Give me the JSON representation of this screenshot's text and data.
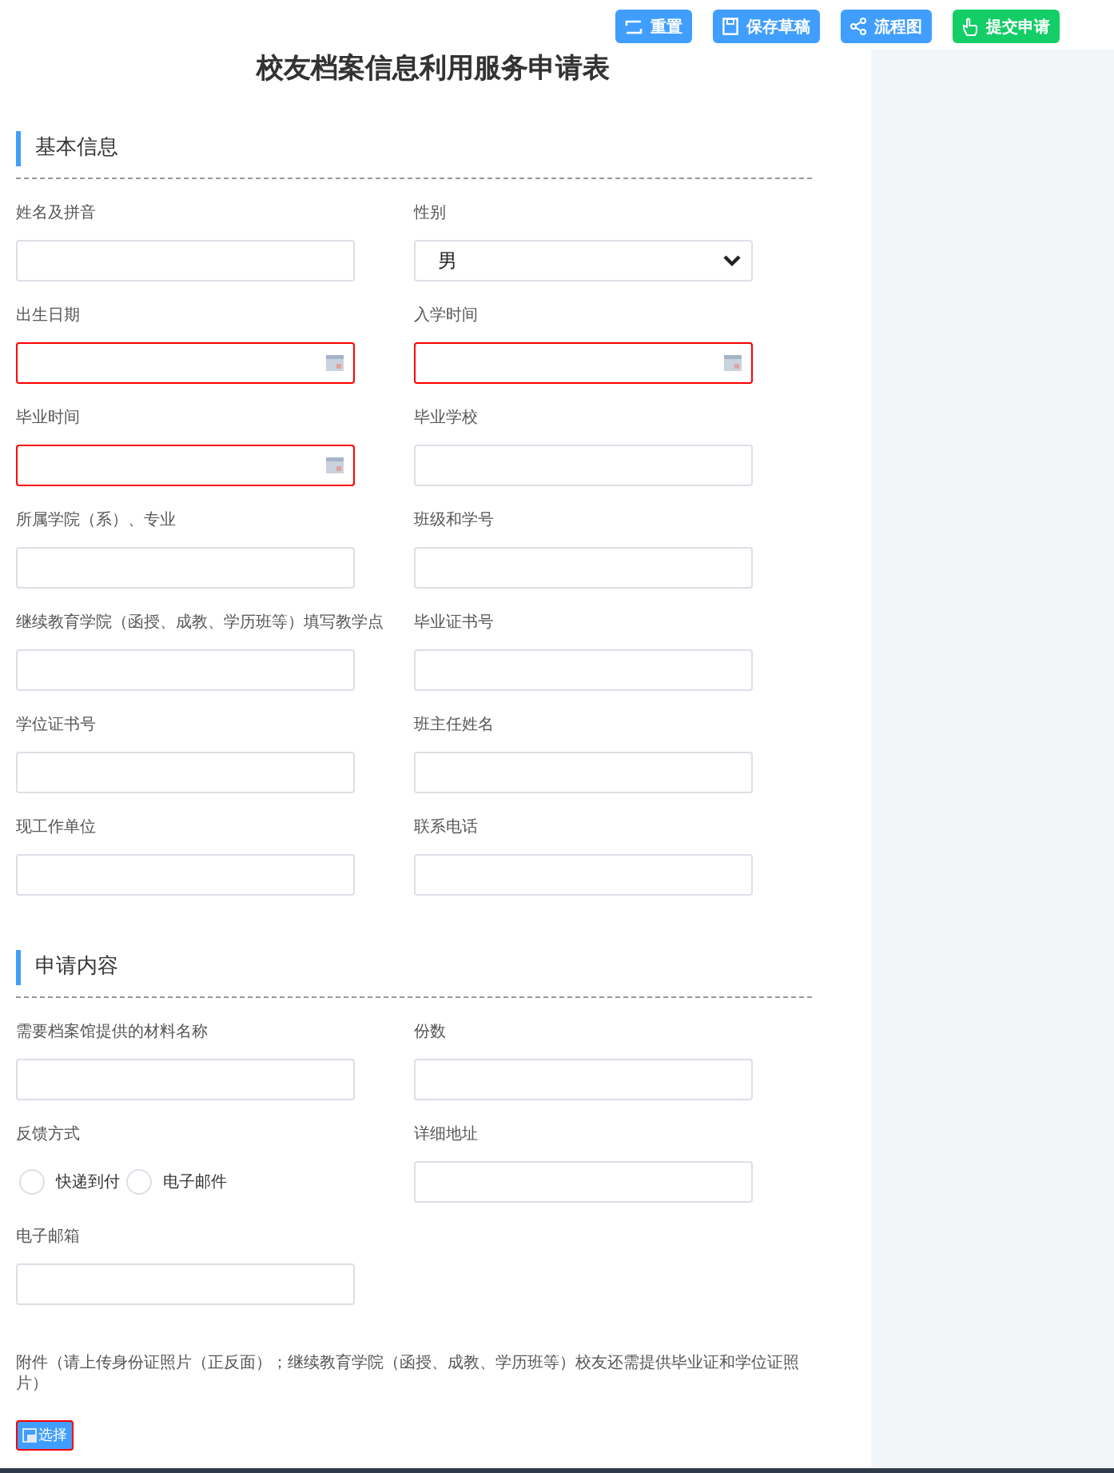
{
  "toolbar": [
    {
      "label": "重置",
      "kind": "reset",
      "color": "#409eff"
    },
    {
      "label": "保存草稿",
      "kind": "save",
      "color": "#409eff"
    },
    {
      "label": "流程图",
      "kind": "flow",
      "color": "#409eff"
    },
    {
      "label": "提交申请",
      "kind": "submit",
      "color": "#13ce66"
    }
  ],
  "title": "校友档案信息利用服务申请表",
  "sections": [
    {
      "heading": "基本信息",
      "fields": [
        {
          "label": "姓名及拼音",
          "kind": "text",
          "invalid": false
        },
        {
          "label": "性别",
          "kind": "select",
          "value": "男",
          "invalid": false
        },
        {
          "label": "出生日期",
          "kind": "date",
          "invalid": true
        },
        {
          "label": "入学时间",
          "kind": "date",
          "invalid": true
        },
        {
          "label": "毕业时间",
          "kind": "date",
          "invalid": true
        },
        {
          "label": "毕业学校",
          "kind": "text",
          "invalid": false
        },
        {
          "label": "所属学院（系）、专业",
          "kind": "text",
          "invalid": false
        },
        {
          "label": "班级和学号",
          "kind": "text",
          "invalid": false
        },
        {
          "label": "继续教育学院（函授、成教、学历班等）填写教学点",
          "kind": "text",
          "invalid": false
        },
        {
          "label": "毕业证书号",
          "kind": "text",
          "invalid": false
        },
        {
          "label": "学位证书号",
          "kind": "text",
          "invalid": false
        },
        {
          "label": "班主任姓名",
          "kind": "text",
          "invalid": false
        },
        {
          "label": "现工作单位",
          "kind": "text",
          "invalid": false
        },
        {
          "label": "联系电话",
          "kind": "text",
          "invalid": false
        }
      ]
    },
    {
      "heading": "申请内容",
      "fields": [
        {
          "label": "需要档案馆提供的材料名称",
          "kind": "text",
          "invalid": false
        },
        {
          "label": "份数",
          "kind": "text",
          "invalid": false
        },
        {
          "label": "反馈方式",
          "kind": "radio",
          "options": [
            {
              "label": "快递到付",
              "selected": false
            },
            {
              "label": "电子邮件",
              "selected": false
            }
          ]
        },
        {
          "label": "详细地址",
          "kind": "text",
          "invalid": false
        },
        {
          "label": "电子邮箱",
          "kind": "text",
          "invalid": false
        }
      ]
    }
  ],
  "attachment": {
    "label": "附件（请上传身份证照片（正反面）；继续教育学院（函授、成教、学历班等）校友还需提供毕业证和学位证照片）",
    "button": "选择"
  }
}
